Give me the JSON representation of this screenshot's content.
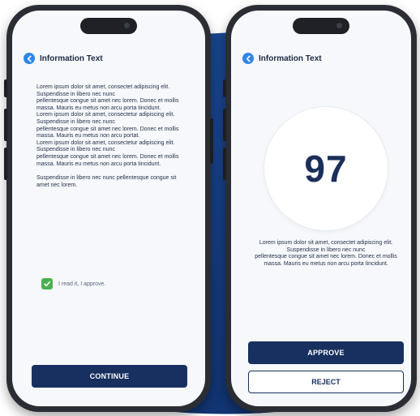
{
  "colors": {
    "brand_navy": "#17305f",
    "accent_blue": "#2f86e6",
    "check_green": "#4caf50",
    "screen_bg": "#f6f8fb"
  },
  "icons": {
    "back": "back-arrow-icon",
    "check": "checkmark-icon"
  },
  "left_screen": {
    "header_title": "Information Text",
    "paragraphs": [
      "Lorem ipsum dolor sit amet, consectet adipiscing elit. Suspendisse in libero nec nunc",
      "pellentesque congue sit amet nec lorem. Donec et mollis massa. Mauris eu metus non arcu porta tincidunt.",
      "Lorem ipsum dolor sit amet, consectetur adipiscing elit. Suspendisse in libero nec nunc",
      "pellentesque congue sit amet nec lorem. Donec et mollis massa. Mauris eu metus non arcu portat.",
      "Lorem ipsum dolor sit amet, consectetur adipiscing elit. Suspendisse in libero nec nunc",
      "pellentesque congue sit amet nec lorem. Donec et mollis massa. Mauris eu metus non arcu porta tincidunt.",
      "Suspendisse in libero nec nunc pellentesque congue sit amet nec lorem."
    ],
    "checkbox_label": "I read it, I approve.",
    "checkbox_checked": true,
    "continue_label": "CONTINUE"
  },
  "right_screen": {
    "header_title": "Information Text",
    "score": "97",
    "paragraphs": [
      "Lorem ipsum dolor sit amet, consectet adipiscing elit. Suspendisse in libero nec nunc",
      "pellentesque congue sit amet nec lorem. Donec et mollis massa. Mauris eu metus non arcu porta tincidunt."
    ],
    "approve_label": "APPROVE",
    "reject_label": "REJECT"
  }
}
